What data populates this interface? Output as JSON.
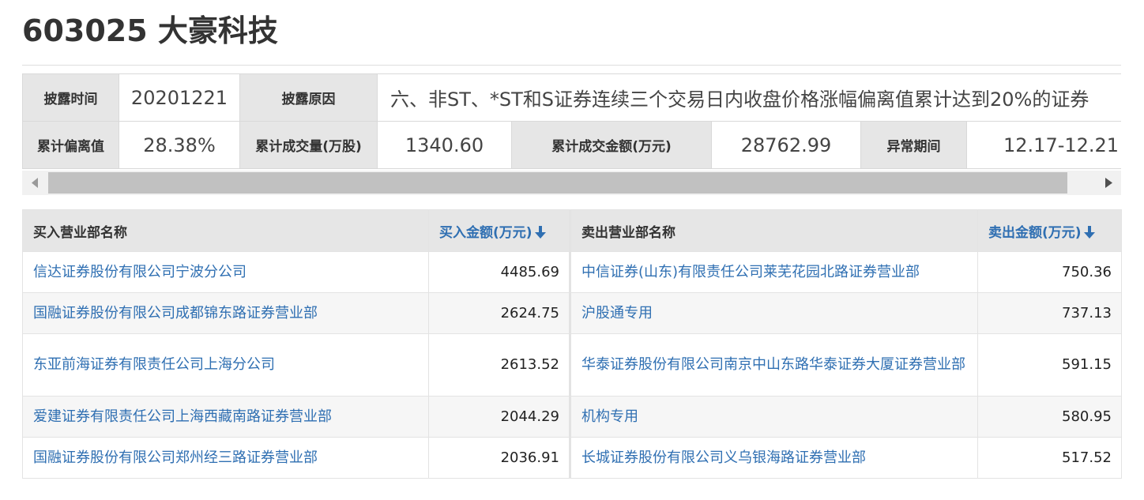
{
  "page": {
    "title": "603025 大豪科技"
  },
  "disclosure": {
    "time_label": "披露时间",
    "time_value": "20201221",
    "reason_label": "披露原因",
    "reason_value": "六、非ST、*ST和S证券连续三个交易日内收盘价格涨幅偏离值累计达到20%的证券",
    "deviation_label": "累计偏离值",
    "deviation_value": "28.38%",
    "volume_label": "累计成交量(万股)",
    "volume_value": "1340.60",
    "amount_label": "累计成交金额(万元)",
    "amount_value": "28762.99",
    "period_label": "异常期间",
    "period_value": "12.17-12.21"
  },
  "trades": {
    "headers": {
      "buy_name": "买入营业部名称",
      "buy_amount": "买入金额(万元)",
      "sell_name": "卖出营业部名称",
      "sell_amount": "卖出金额(万元)"
    },
    "rows": [
      {
        "buy_name": "信达证券股份有限公司宁波分公司",
        "buy_amount": "4485.69",
        "sell_name": "中信证券(山东)有限责任公司莱芜花园北路证券营业部",
        "sell_amount": "750.36"
      },
      {
        "buy_name": "国融证券股份有限公司成都锦东路证券营业部",
        "buy_amount": "2624.75",
        "sell_name": "沪股通专用",
        "sell_amount": "737.13"
      },
      {
        "buy_name": "东亚前海证券有限责任公司上海分公司",
        "buy_amount": "2613.52",
        "sell_name": "华泰证券股份有限公司南京中山东路华泰证券大厦证券营业部",
        "sell_amount": "591.15"
      },
      {
        "buy_name": "爱建证券有限责任公司上海西藏南路证券营业部",
        "buy_amount": "2044.29",
        "sell_name": "机构专用",
        "sell_amount": "580.95"
      },
      {
        "buy_name": "国融证券股份有限公司郑州经三路证券营业部",
        "buy_amount": "2036.91",
        "sell_name": "长城证券股份有限公司义乌银海路证券营业部",
        "sell_amount": "517.52"
      }
    ]
  },
  "colors": {
    "link": "#2f6fb2",
    "header_bg": "#e6e6e6"
  }
}
